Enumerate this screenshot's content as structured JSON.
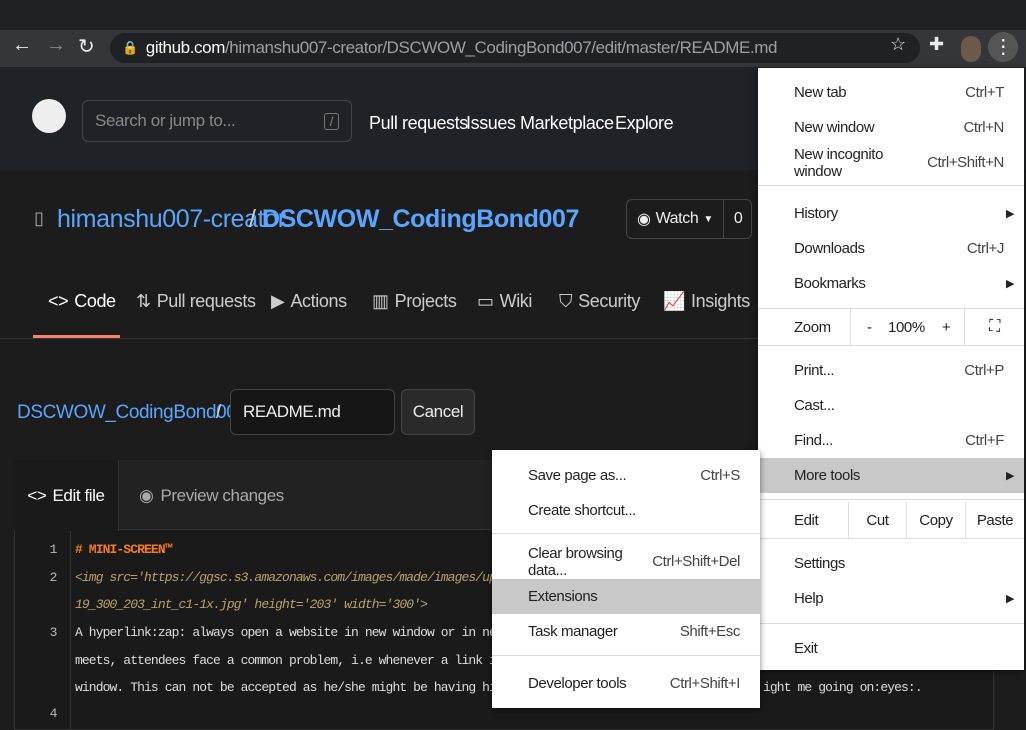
{
  "browser": {
    "url_host": "github.com",
    "url_path": "/himanshu007-creator/DSCWOW_CodingBond007/edit/master/README.md"
  },
  "github": {
    "search_placeholder": "Search or jump to...",
    "search_key": "/",
    "nav": [
      "Pull requests",
      "Issues",
      "Marketplace",
      "Explore"
    ],
    "owner": "himanshu007-creator",
    "sep": "/",
    "repo": "DSCWOW_CodingBond007",
    "watch_label": "Watch",
    "watch_count": "0",
    "tabs": [
      "Code",
      "Pull requests",
      "Actions",
      "Projects",
      "Wiki",
      "Security",
      "Insights"
    ],
    "breadcrumb_repo": "DSCWOW_CodingBond007",
    "filename": "README.md",
    "cancel": "Cancel",
    "edit_tab": "Edit file",
    "preview_tab": "Preview changes",
    "line_numbers": [
      "1",
      "2",
      "3",
      "4"
    ],
    "code": [
      "# MINI-SCREEN™",
      "<img src='https://ggsc.s3.amazonaws.com/images/made/images/uplo",
      "19_300_203_int_c1-1x.jpg' height='203' width='300'>",
      "A hyperlink:zap: always open a website in new window or in new",
      "meets, attendees face a common problem, i.e whenever a link is",
      "window. This can not be accepted as he/she might be having his",
      "ight me going on:eyes:."
    ]
  },
  "chrome_menu": {
    "items1": [
      {
        "label": "New tab",
        "shortcut": "Ctrl+T"
      },
      {
        "label": "New window",
        "shortcut": "Ctrl+N"
      },
      {
        "label": "New incognito window",
        "shortcut": "Ctrl+Shift+N"
      }
    ],
    "items2": [
      {
        "label": "History"
      },
      {
        "label": "Downloads",
        "shortcut": "Ctrl+J"
      },
      {
        "label": "Bookmarks"
      }
    ],
    "zoom": {
      "label": "Zoom",
      "minus": "-",
      "value": "100%",
      "plus": "+"
    },
    "items3": [
      {
        "label": "Print...",
        "shortcut": "Ctrl+P"
      },
      {
        "label": "Cast..."
      },
      {
        "label": "Find...",
        "shortcut": "Ctrl+F"
      },
      {
        "label": "More tools"
      }
    ],
    "edit": {
      "label": "Edit",
      "cut": "Cut",
      "copy": "Copy",
      "paste": "Paste"
    },
    "items4": [
      {
        "label": "Settings"
      },
      {
        "label": "Help"
      }
    ],
    "exit": "Exit"
  },
  "more_tools": {
    "items": [
      {
        "label": "Save page as...",
        "shortcut": "Ctrl+S"
      },
      {
        "label": "Create shortcut..."
      },
      {
        "label": "Clear browsing data...",
        "shortcut": "Ctrl+Shift+Del"
      },
      {
        "label": "Extensions"
      },
      {
        "label": "Task manager",
        "shortcut": "Shift+Esc"
      },
      {
        "label": "Developer tools",
        "shortcut": "Ctrl+Shift+I"
      }
    ]
  }
}
